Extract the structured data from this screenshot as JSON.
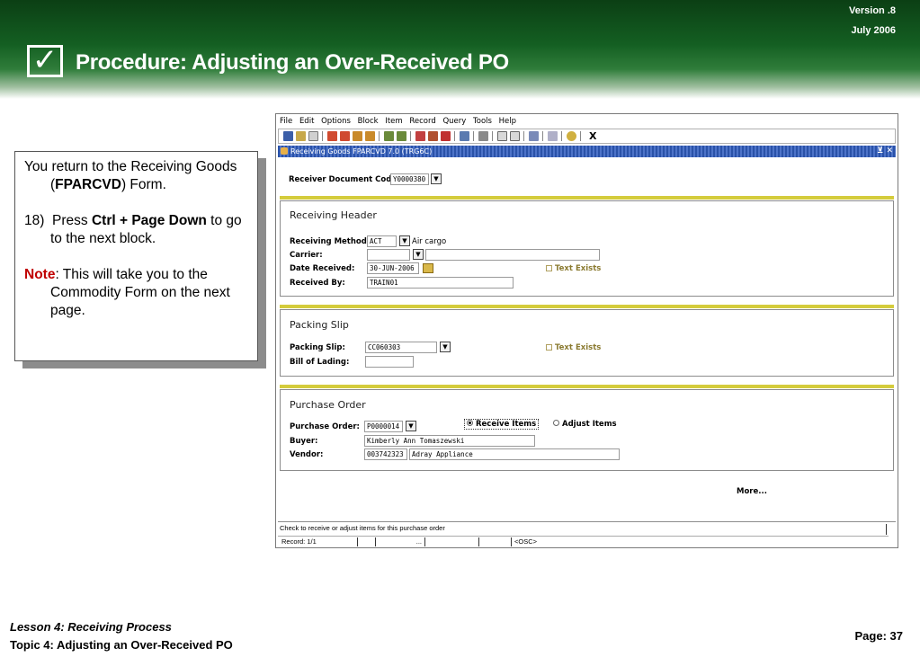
{
  "slide": {
    "title": "Procedure:  Adjusting an Over-Received PO",
    "version": "Version .8",
    "date": "July  2006",
    "check_glyph": "✓"
  },
  "callout": {
    "intro": "You return to the Receiving Goods (FPARCVD) Form.",
    "intro_pre": "You return to the Receiving Goods (",
    "intro_code": "FPARCVD",
    "intro_post": ") Form.",
    "step_num": "18)",
    "step_pre": "Press ",
    "step_key": "Ctrl + Page Down",
    "step_post": " to go to the next block.",
    "note_label": "Note",
    "note_text": ":  This will take you to the Commodity Form on the next page."
  },
  "app": {
    "menu": [
      "File",
      "Edit",
      "Options",
      "Block",
      "Item",
      "Record",
      "Query",
      "Tools",
      "Help"
    ],
    "toolbar_exit": "X",
    "window_title": "Receiving Goods  FPARCVD  7.0  (TRG6C)",
    "window_controls": "⊻ ✕",
    "receiver_doc_label": "Receiver Document Code",
    "receiver_doc_value": "Y0000380",
    "receiving_header": {
      "title": "Receiving Header",
      "method_label": "Receiving Method:",
      "method_value": "ACT",
      "method_desc": "Air cargo",
      "carrier_label": "Carrier:",
      "carrier_value": "",
      "date_label": "Date Received:",
      "date_value": "30-JUN-2006",
      "received_by_label": "Received By:",
      "received_by_value": "TRAIN01",
      "text_exists": "Text Exists"
    },
    "packing_slip": {
      "title": "Packing Slip",
      "slip_label": "Packing Slip:",
      "slip_value": "CC060303",
      "lading_label": "Bill of Lading:",
      "lading_value": "",
      "text_exists": "Text Exists"
    },
    "purchase_order": {
      "title": "Purchase Order",
      "po_label": "Purchase Order:",
      "po_value": "P0000014",
      "receive_items": "Receive Items",
      "adjust_items": "Adjust Items",
      "buyer_label": "Buyer:",
      "buyer_value": "Kimberly Ann  Tomaszewski",
      "vendor_label": "Vendor:",
      "vendor_id": "003742323",
      "vendor_name": "Adray Appliance"
    },
    "more_label": "More...",
    "status_hint": "Check to receive or adjust items for this purchase order",
    "record_text": "Record: 1/1",
    "record_dots": "...",
    "record_osc": "<OSC>"
  },
  "footer": {
    "lesson": "Lesson 4: Receiving Process",
    "topic": "Topic 4: Adjusting an Over-Received PO",
    "page": "Page: 37"
  },
  "colors": {
    "header_green": "#145f22",
    "titlebar_blue": "#2a52a8",
    "divider_yellow": "#d4cc3c",
    "note_red": "#c00000"
  }
}
